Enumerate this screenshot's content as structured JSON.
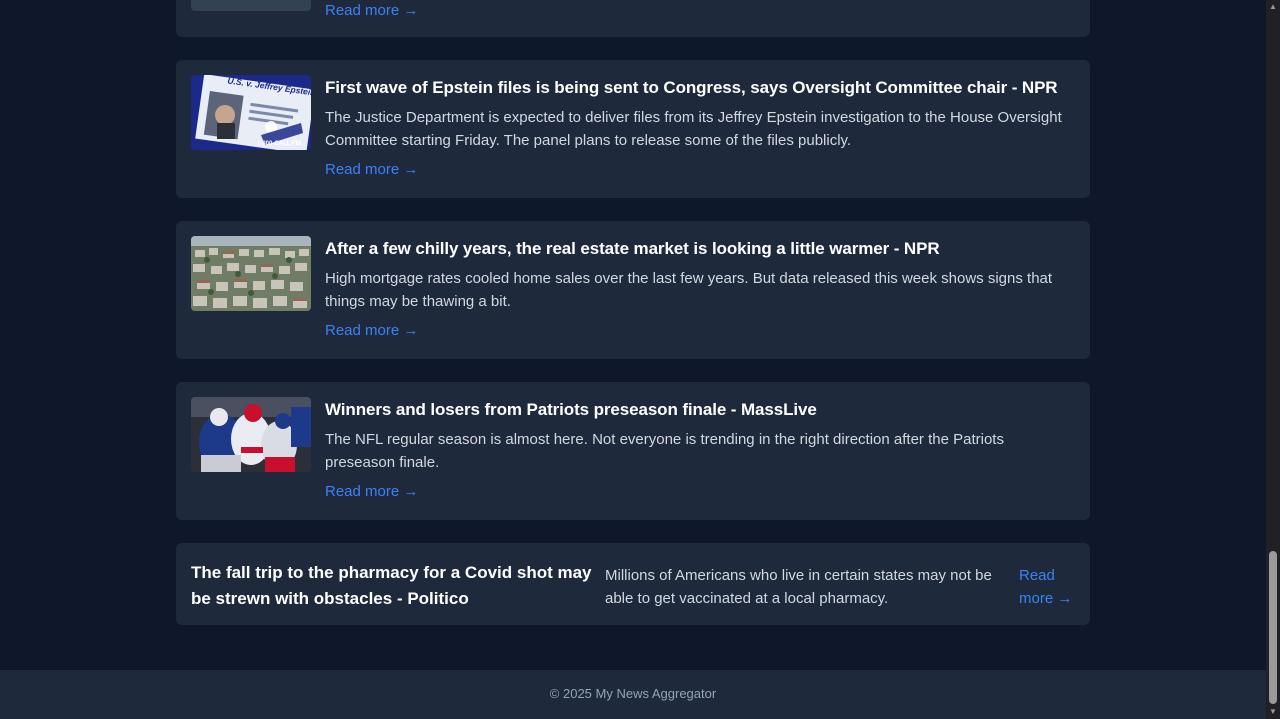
{
  "articles": [
    {
      "read_more": "Read more →"
    },
    {
      "title": "First wave of Epstein files is being sent to Congress, says Oversight Committee chair - NPR",
      "description": "The Justice Department is expected to deliver files from its Jeffrey Epstein investigation to the House Oversight Committee starting Friday. The panel plans to release some of the files publicly.",
      "read_more": "Read more →",
      "image_caption_top": "U.S. v. Jeffrey Epstein",
      "image_caption_bottom": "1-800-CALL FBI"
    },
    {
      "title": "After a few chilly years, the real estate market is looking a little warmer - NPR",
      "description": "High mortgage rates cooled home sales over the last few years. But data released this week shows signs that things may be thawing a bit.",
      "read_more": "Read more →"
    },
    {
      "title": "Winners and losers from Patriots preseason finale - MassLive",
      "description": "The NFL regular season is almost here. Not everyone is trending in the right direction after the Patriots preseason finale.",
      "read_more": "Read more →"
    },
    {
      "title": "The fall trip to the pharmacy for a Covid shot may be strewn with obstacles - Politico",
      "description": "Millions of Americans who live in certain states may not be able to get vaccinated at a local pharmacy.",
      "read_more": "Read more →"
    }
  ],
  "footer": {
    "text": "© 2025 My News Aggregator"
  },
  "colors": {
    "page_bg": "#0f172a",
    "card_bg": "#1e293b",
    "link": "#3b82f6",
    "title": "#ffffff",
    "body_text": "#d3d8e0",
    "footer_text": "#94a3b8"
  }
}
